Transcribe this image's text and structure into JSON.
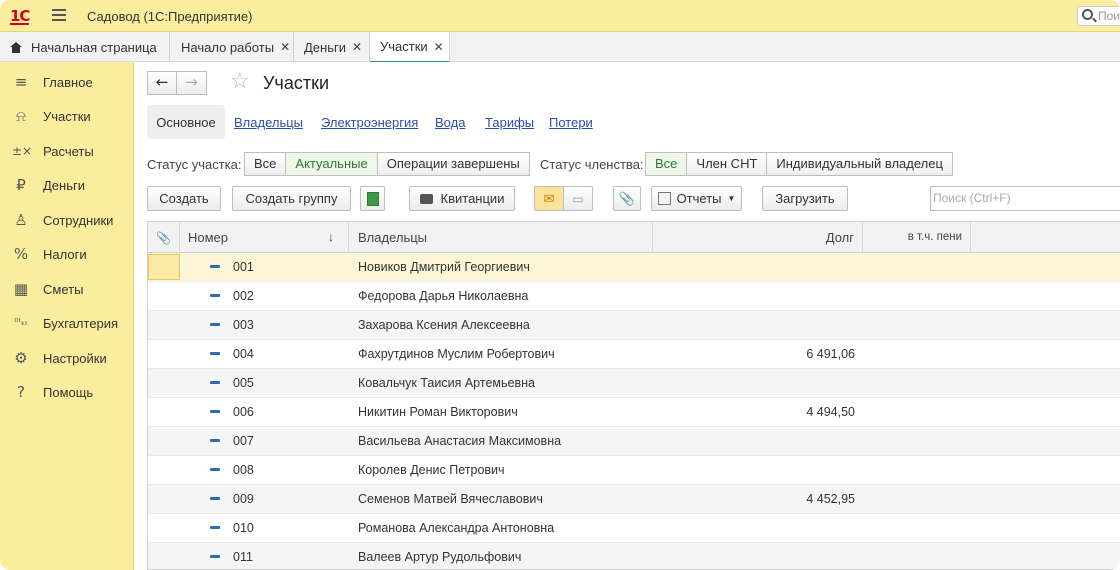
{
  "app": {
    "logo": "1С",
    "title": "Садовод  (1С:Предприятие)",
    "search_placeholder": "Пои"
  },
  "tabs": [
    {
      "label": "Начальная страница"
    },
    {
      "label": "Начало работы"
    },
    {
      "label": "Деньги"
    },
    {
      "label": "Участки"
    }
  ],
  "sidebar": {
    "items": [
      {
        "label": "Главное",
        "icon": "menu-lines-icon"
      },
      {
        "label": "Участки",
        "icon": "tree-icon"
      },
      {
        "label": "Расчеты",
        "icon": "calc-icon"
      },
      {
        "label": "Деньги",
        "icon": "ruble-icon"
      },
      {
        "label": "Сотрудники",
        "icon": "person-icon"
      },
      {
        "label": "Налоги",
        "icon": "percent-icon"
      },
      {
        "label": "Сметы",
        "icon": "calculator-icon"
      },
      {
        "label": "Бухгалтерия",
        "icon": "dt-kt-icon"
      },
      {
        "label": "Настройки",
        "icon": "gear-icon"
      },
      {
        "label": "Помощь",
        "icon": "question-icon"
      }
    ]
  },
  "page": {
    "title": "Участки",
    "subtabs": [
      "Основное",
      "Владельцы",
      "Электроэнергия",
      "Вода",
      "Тарифы",
      "Потери"
    ]
  },
  "filters": {
    "status_label": "Статус участка:",
    "status_options": [
      "Все",
      "Актуальные",
      "Операции завершены"
    ],
    "status_selected": "Актуальные",
    "member_label": "Статус членства:",
    "member_options": [
      "Все",
      "Член СНТ",
      "Индивидуальный владелец"
    ],
    "member_selected": "Все"
  },
  "toolbar": {
    "create": "Создать",
    "create_group": "Создать группу",
    "receipts": "Квитанции",
    "reports": "Отчеты",
    "load": "Загрузить",
    "search_placeholder": "Поиск (Ctrl+F)"
  },
  "table": {
    "columns": [
      "Номер",
      "Владельцы",
      "Долг",
      "в т.ч. пени"
    ],
    "rows": [
      {
        "num": "001",
        "owner": "Новиков Дмитрий Георгиевич",
        "debt": "",
        "penalty": ""
      },
      {
        "num": "002",
        "owner": "Федорова Дарья Николаевна",
        "debt": "",
        "penalty": ""
      },
      {
        "num": "003",
        "owner": "Захарова Ксения Алексеевна",
        "debt": "",
        "penalty": ""
      },
      {
        "num": "004",
        "owner": "Фахрутдинов Муслим Робертович",
        "debt": "6 491,06",
        "penalty": ""
      },
      {
        "num": "005",
        "owner": "Ковальчук Таисия Артемьевна",
        "debt": "",
        "penalty": ""
      },
      {
        "num": "006",
        "owner": "Никитин Роман Викторович",
        "debt": "4 494,50",
        "penalty": ""
      },
      {
        "num": "007",
        "owner": "Васильева Анастасия Максимовна",
        "debt": "",
        "penalty": ""
      },
      {
        "num": "008",
        "owner": "Королев Денис Петрович",
        "debt": "",
        "penalty": ""
      },
      {
        "num": "009",
        "owner": "Семенов Матвей Вячеславович",
        "debt": "4 452,95",
        "penalty": ""
      },
      {
        "num": "010",
        "owner": "Романова Александра Антоновна",
        "debt": "",
        "penalty": ""
      },
      {
        "num": "011",
        "owner": "Валеев Артур Рудольфович",
        "debt": "",
        "penalty": ""
      }
    ]
  },
  "colors": {
    "sidebar_bg": "#fbed9e",
    "accent_green": "#2b9a5a",
    "link_blue": "#2b4fae",
    "selected_row": "#fdf6d6"
  }
}
